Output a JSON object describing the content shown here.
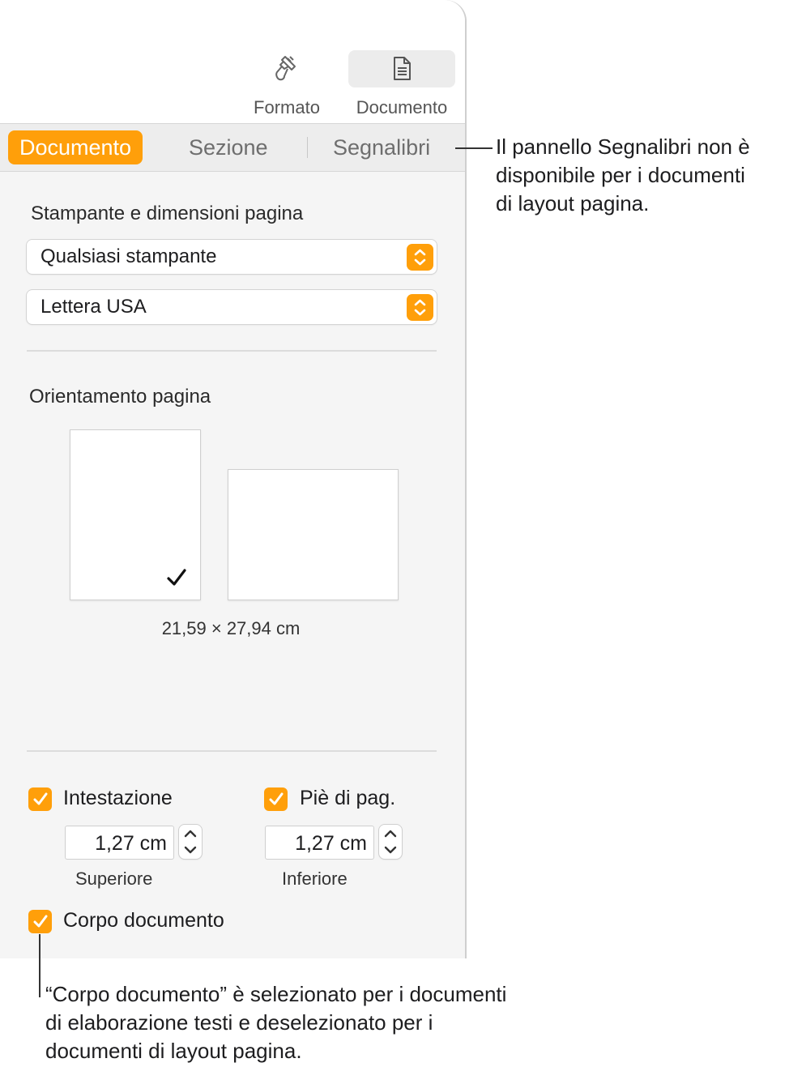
{
  "toolbar": {
    "format_label": "Formato",
    "document_label": "Documento"
  },
  "tabs": [
    {
      "label": "Documento",
      "active": true
    },
    {
      "label": "Sezione",
      "active": false
    },
    {
      "label": "Segnalibri",
      "active": false
    }
  ],
  "printer_section": {
    "title": "Stampante e dimensioni pagina",
    "printer_value": "Qualsiasi stampante",
    "paper_value": "Lettera USA"
  },
  "orientation_section": {
    "title": "Orientamento pagina",
    "selected": "portrait",
    "dimensions": "21,59 × 27,94 cm"
  },
  "header_footer": {
    "header_label": "Intestazione",
    "header_checked": true,
    "header_value": "1,27 cm",
    "header_sub_label": "Superiore",
    "footer_label": "Piè di pag.",
    "footer_checked": true,
    "footer_value": "1,27 cm",
    "footer_sub_label": "Inferiore"
  },
  "body_checkbox": {
    "label": "Corpo documento",
    "checked": true
  },
  "callouts": {
    "bookmarks": [
      "Il pannello Segnalibri non è",
      "disponibile per i documenti",
      "di layout pagina."
    ],
    "body": [
      "“Corpo documento” è selezionato per i documenti",
      "di elaborazione testi e deselezionato per i",
      "documenti di layout pagina."
    ]
  },
  "colors": {
    "accent": "#ff9f0a",
    "panel_bg": "#f5f5f5"
  },
  "icons": {
    "format": "paintbrush-icon",
    "document": "document-icon",
    "stepper": "chevron-updown-icon",
    "check": "checkmark-icon"
  }
}
